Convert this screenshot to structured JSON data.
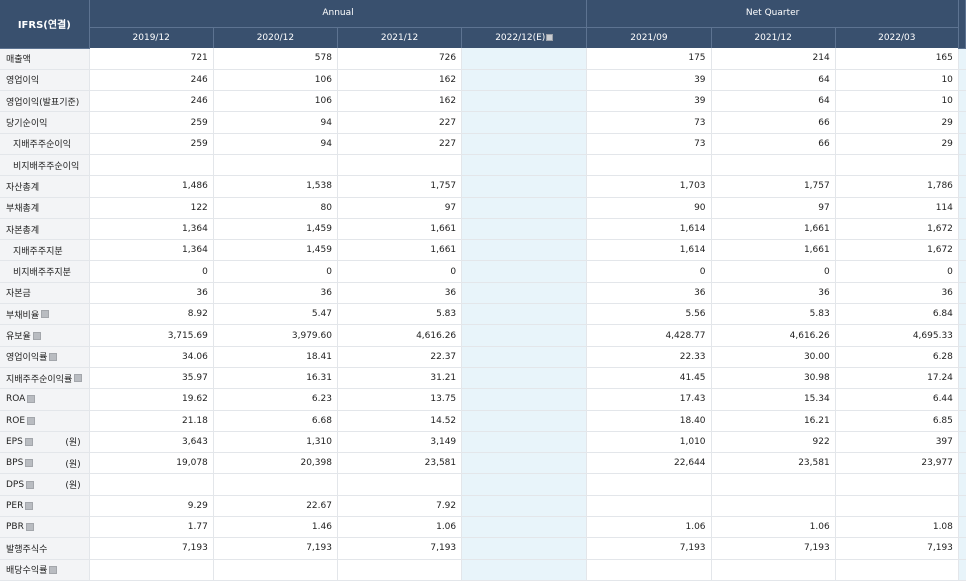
{
  "header": {
    "corner": "IFRS(연결)",
    "annual_label": "Annual",
    "quarter_label": "Net Quarter",
    "periods": [
      "2019/12",
      "2020/12",
      "2021/12",
      "2022/12(E)",
      "2021/09",
      "2021/12",
      "2022/03"
    ]
  },
  "rows": [
    {
      "label": "매출액",
      "values": [
        "721",
        "578",
        "726",
        "",
        "175",
        "214",
        "165"
      ]
    },
    {
      "label": "영업이익",
      "values": [
        "246",
        "106",
        "162",
        "",
        "39",
        "64",
        "10"
      ]
    },
    {
      "label": "영업이익(발표기준)",
      "values": [
        "246",
        "106",
        "162",
        "",
        "39",
        "64",
        "10"
      ]
    },
    {
      "label": "당기순이익",
      "values": [
        "259",
        "94",
        "227",
        "",
        "73",
        "66",
        "29"
      ]
    },
    {
      "label": "지배주주순이익",
      "values": [
        "259",
        "94",
        "227",
        "",
        "73",
        "66",
        "29"
      ]
    },
    {
      "label": "비지배주주순이익",
      "values": [
        "",
        "",
        "",
        "",
        "",
        "",
        ""
      ]
    },
    {
      "label": "자산총계",
      "values": [
        "1,486",
        "1,538",
        "1,757",
        "",
        "1,703",
        "1,757",
        "1,786"
      ]
    },
    {
      "label": "부채총계",
      "values": [
        "122",
        "80",
        "97",
        "",
        "90",
        "97",
        "114"
      ]
    },
    {
      "label": "자본총계",
      "values": [
        "1,364",
        "1,459",
        "1,661",
        "",
        "1,614",
        "1,661",
        "1,672"
      ]
    },
    {
      "label": "지배주주지분",
      "values": [
        "1,364",
        "1,459",
        "1,661",
        "",
        "1,614",
        "1,661",
        "1,672"
      ]
    },
    {
      "label": "비지배주주지분",
      "values": [
        "0",
        "0",
        "0",
        "",
        "0",
        "0",
        "0"
      ]
    },
    {
      "label": "자본금",
      "values": [
        "36",
        "36",
        "36",
        "",
        "36",
        "36",
        "36"
      ]
    },
    {
      "label": "부채비율",
      "values": [
        "8.92",
        "5.47",
        "5.83",
        "",
        "5.56",
        "5.83",
        "6.84"
      ]
    },
    {
      "label": "유보율",
      "values": [
        "3,715.69",
        "3,979.60",
        "4,616.26",
        "",
        "4,428.77",
        "4,616.26",
        "4,695.33"
      ]
    },
    {
      "label": "영업이익률",
      "values": [
        "34.06",
        "18.41",
        "22.37",
        "",
        "22.33",
        "30.00",
        "6.28"
      ]
    },
    {
      "label": "지배주주순이익률",
      "values": [
        "35.97",
        "16.31",
        "31.21",
        "",
        "41.45",
        "30.98",
        "17.24"
      ]
    },
    {
      "label": "ROA",
      "values": [
        "19.62",
        "6.23",
        "13.75",
        "",
        "17.43",
        "15.34",
        "6.44"
      ]
    },
    {
      "label": "ROE",
      "values": [
        "21.18",
        "6.68",
        "14.52",
        "",
        "18.40",
        "16.21",
        "6.85"
      ]
    },
    {
      "label": "EPS",
      "unit": "(원)",
      "values": [
        "3,643",
        "1,310",
        "3,149",
        "",
        "1,010",
        "922",
        "397"
      ]
    },
    {
      "label": "BPS",
      "unit": "(원)",
      "values": [
        "19,078",
        "20,398",
        "23,581",
        "",
        "22,644",
        "23,581",
        "23,977"
      ]
    },
    {
      "label": "DPS",
      "unit": "(원)",
      "values": [
        "",
        "",
        "",
        "",
        "",
        "",
        ""
      ]
    },
    {
      "label": "PER",
      "values": [
        "9.29",
        "22.67",
        "7.92",
        "",
        "",
        "",
        ""
      ]
    },
    {
      "label": "PBR",
      "values": [
        "1.77",
        "1.46",
        "1.06",
        "",
        "1.06",
        "1.06",
        "1.08"
      ]
    },
    {
      "label": "발행주식수",
      "values": [
        "7,193",
        "7,193",
        "7,193",
        "",
        "7,193",
        "7,193",
        "7,193"
      ]
    },
    {
      "label": "배당수익률",
      "values": [
        "",
        "",
        "",
        "",
        "",
        "",
        ""
      ]
    }
  ]
}
